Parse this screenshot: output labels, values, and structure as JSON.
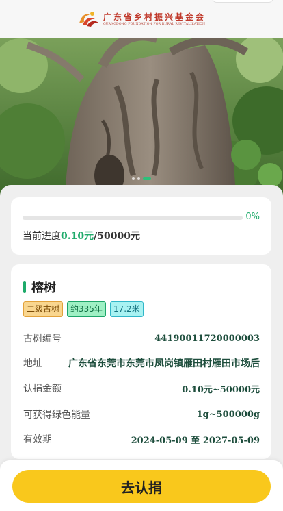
{
  "header": {
    "org_name_cn": "广东省乡村振兴基金会",
    "org_name_en": "GUANGDONG FOUNDATION FOR RURAL REVITALIZATION"
  },
  "hero": {
    "image_icon": "banyan-tree-photo",
    "slides": 3,
    "active_slide": 2
  },
  "progress": {
    "percent_label": "0%",
    "fraction": 0.0,
    "prefix": "当前进度",
    "current": "0.10元",
    "separator": "/",
    "total": "50000元"
  },
  "tree": {
    "name": "榕树",
    "tags": {
      "level": "二级古树",
      "age": "约335年",
      "height": "17.2米"
    },
    "fields": {
      "id_label": "古树编号",
      "id_value": "44190011720000003",
      "address_label": "地址",
      "address_value": "广东省东莞市东莞市凤岗镇雁田村雁田市场后",
      "amount_label": "认捐金额",
      "amount_value": "0.10元~50000元",
      "energy_label": "可获得绿色能量",
      "energy_value": "1g~500000g",
      "validity_label": "有效期",
      "validity_from": "2024-05-09",
      "validity_to_word": "至",
      "validity_to": "2027-05-09"
    }
  },
  "footer": {
    "cta_label": "去认捐"
  },
  "colors": {
    "accent_green": "#1eaa6a",
    "cta_yellow": "#f9c81c",
    "logo_red": "#c0392b"
  }
}
